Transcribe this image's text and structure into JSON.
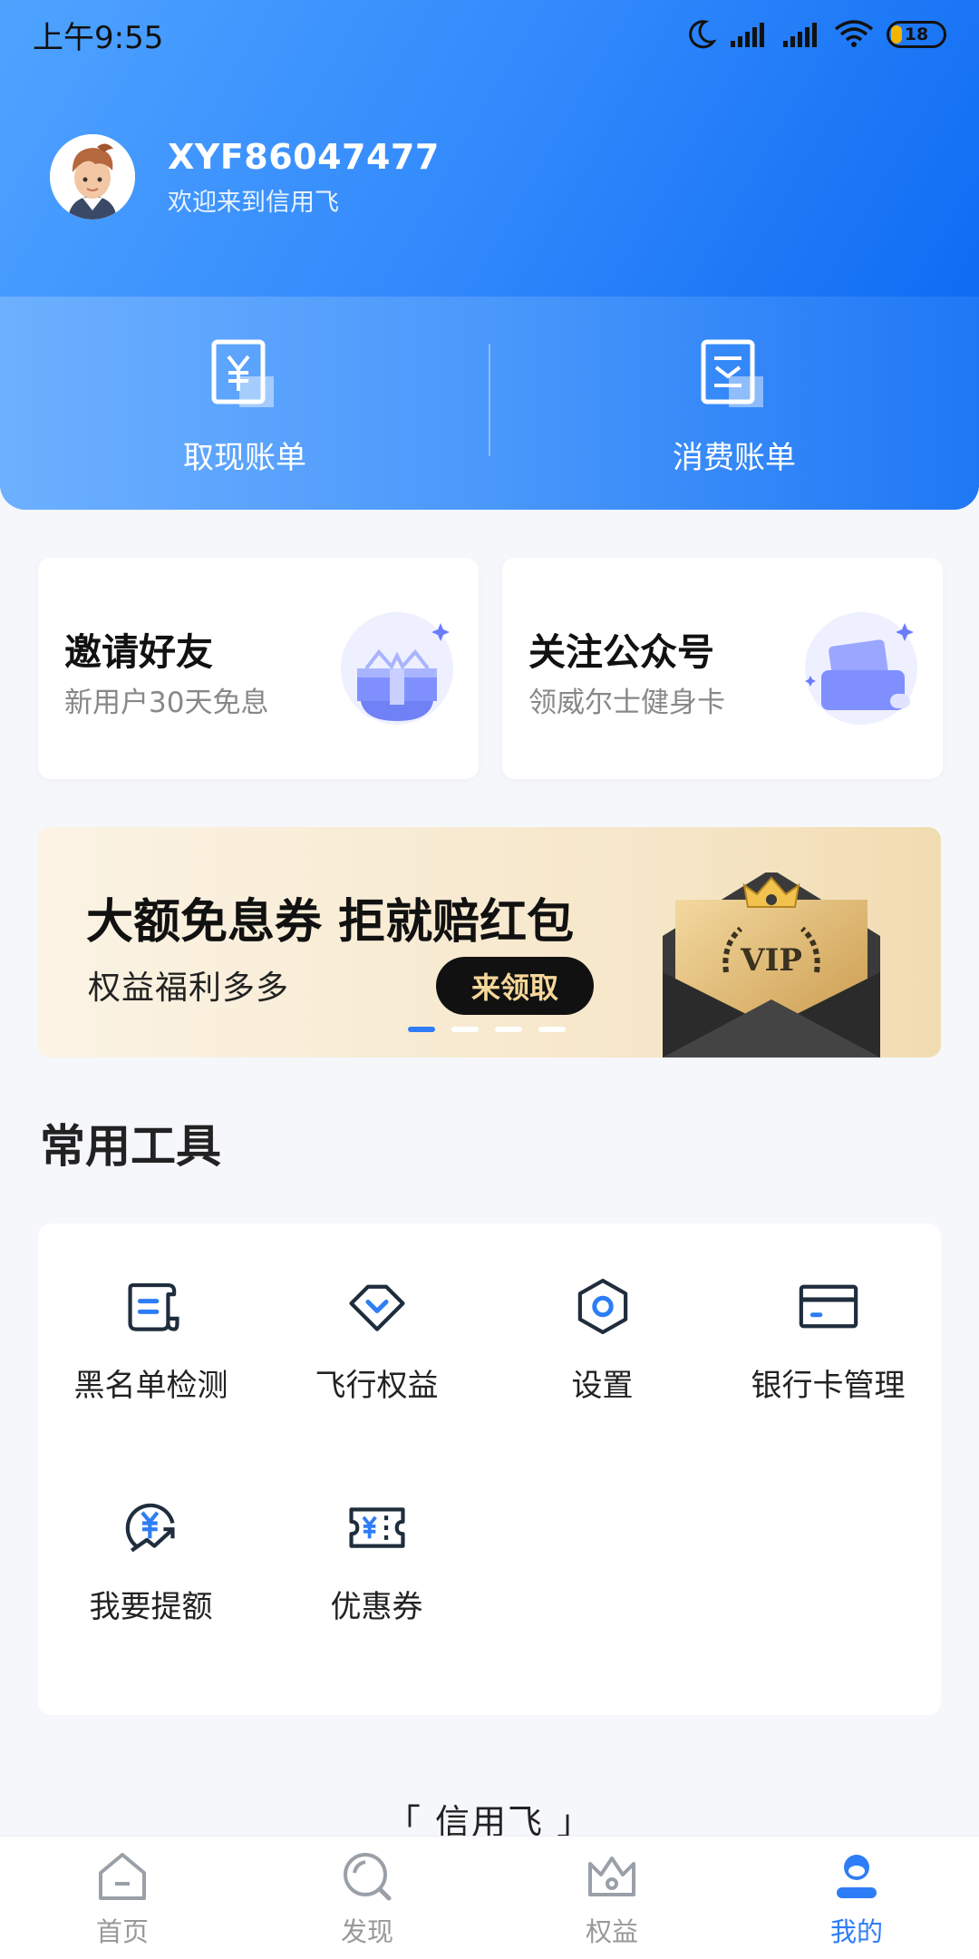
{
  "status_bar": {
    "time": "上午9:55",
    "battery": "18",
    "icons": [
      "moon-icon",
      "signal-icon",
      "signal-icon",
      "wifi-icon",
      "battery-icon"
    ]
  },
  "profile": {
    "username": "XYF86047477",
    "welcome": "欢迎来到信用飞"
  },
  "bills": [
    {
      "label": "取现账单",
      "icon": "cash-bill-icon"
    },
    {
      "label": "消费账单",
      "icon": "consume-bill-icon"
    }
  ],
  "cards": [
    {
      "title": "邀请好友",
      "subtitle": "新用户30天免息",
      "icon": "gift-box-icon"
    },
    {
      "title": "关注公众号",
      "subtitle": "领威尔士健身卡",
      "icon": "card-wallet-icon"
    }
  ],
  "banner": {
    "title": "大额免息券 拒就赔红包",
    "subtitle": "权益福利多多",
    "button": "来领取",
    "pages": 4,
    "active_page": 1
  },
  "tools": {
    "section_title": "常用工具",
    "items": [
      {
        "label": "黑名单检测",
        "icon": "scroll-doc-icon"
      },
      {
        "label": "飞行权益",
        "icon": "diamond-icon"
      },
      {
        "label": "设置",
        "icon": "hex-gear-icon"
      },
      {
        "label": "银行卡管理",
        "icon": "bank-card-icon"
      },
      {
        "label": "我要提额",
        "icon": "yuan-arrow-icon"
      },
      {
        "label": "优惠券",
        "icon": "coupon-icon"
      }
    ]
  },
  "footer": {
    "brand": "「 信用飞 」"
  },
  "nav": {
    "items": [
      {
        "label": "首页",
        "icon": "home-icon"
      },
      {
        "label": "发现",
        "icon": "discover-icon"
      },
      {
        "label": "权益",
        "icon": "crown-icon"
      },
      {
        "label": "我的",
        "icon": "user-icon"
      }
    ],
    "active": "我的"
  },
  "colors": {
    "primary": "#2E7DF6",
    "accent_gold": "#F6D79A",
    "icon_dark": "#1f2d3d"
  }
}
